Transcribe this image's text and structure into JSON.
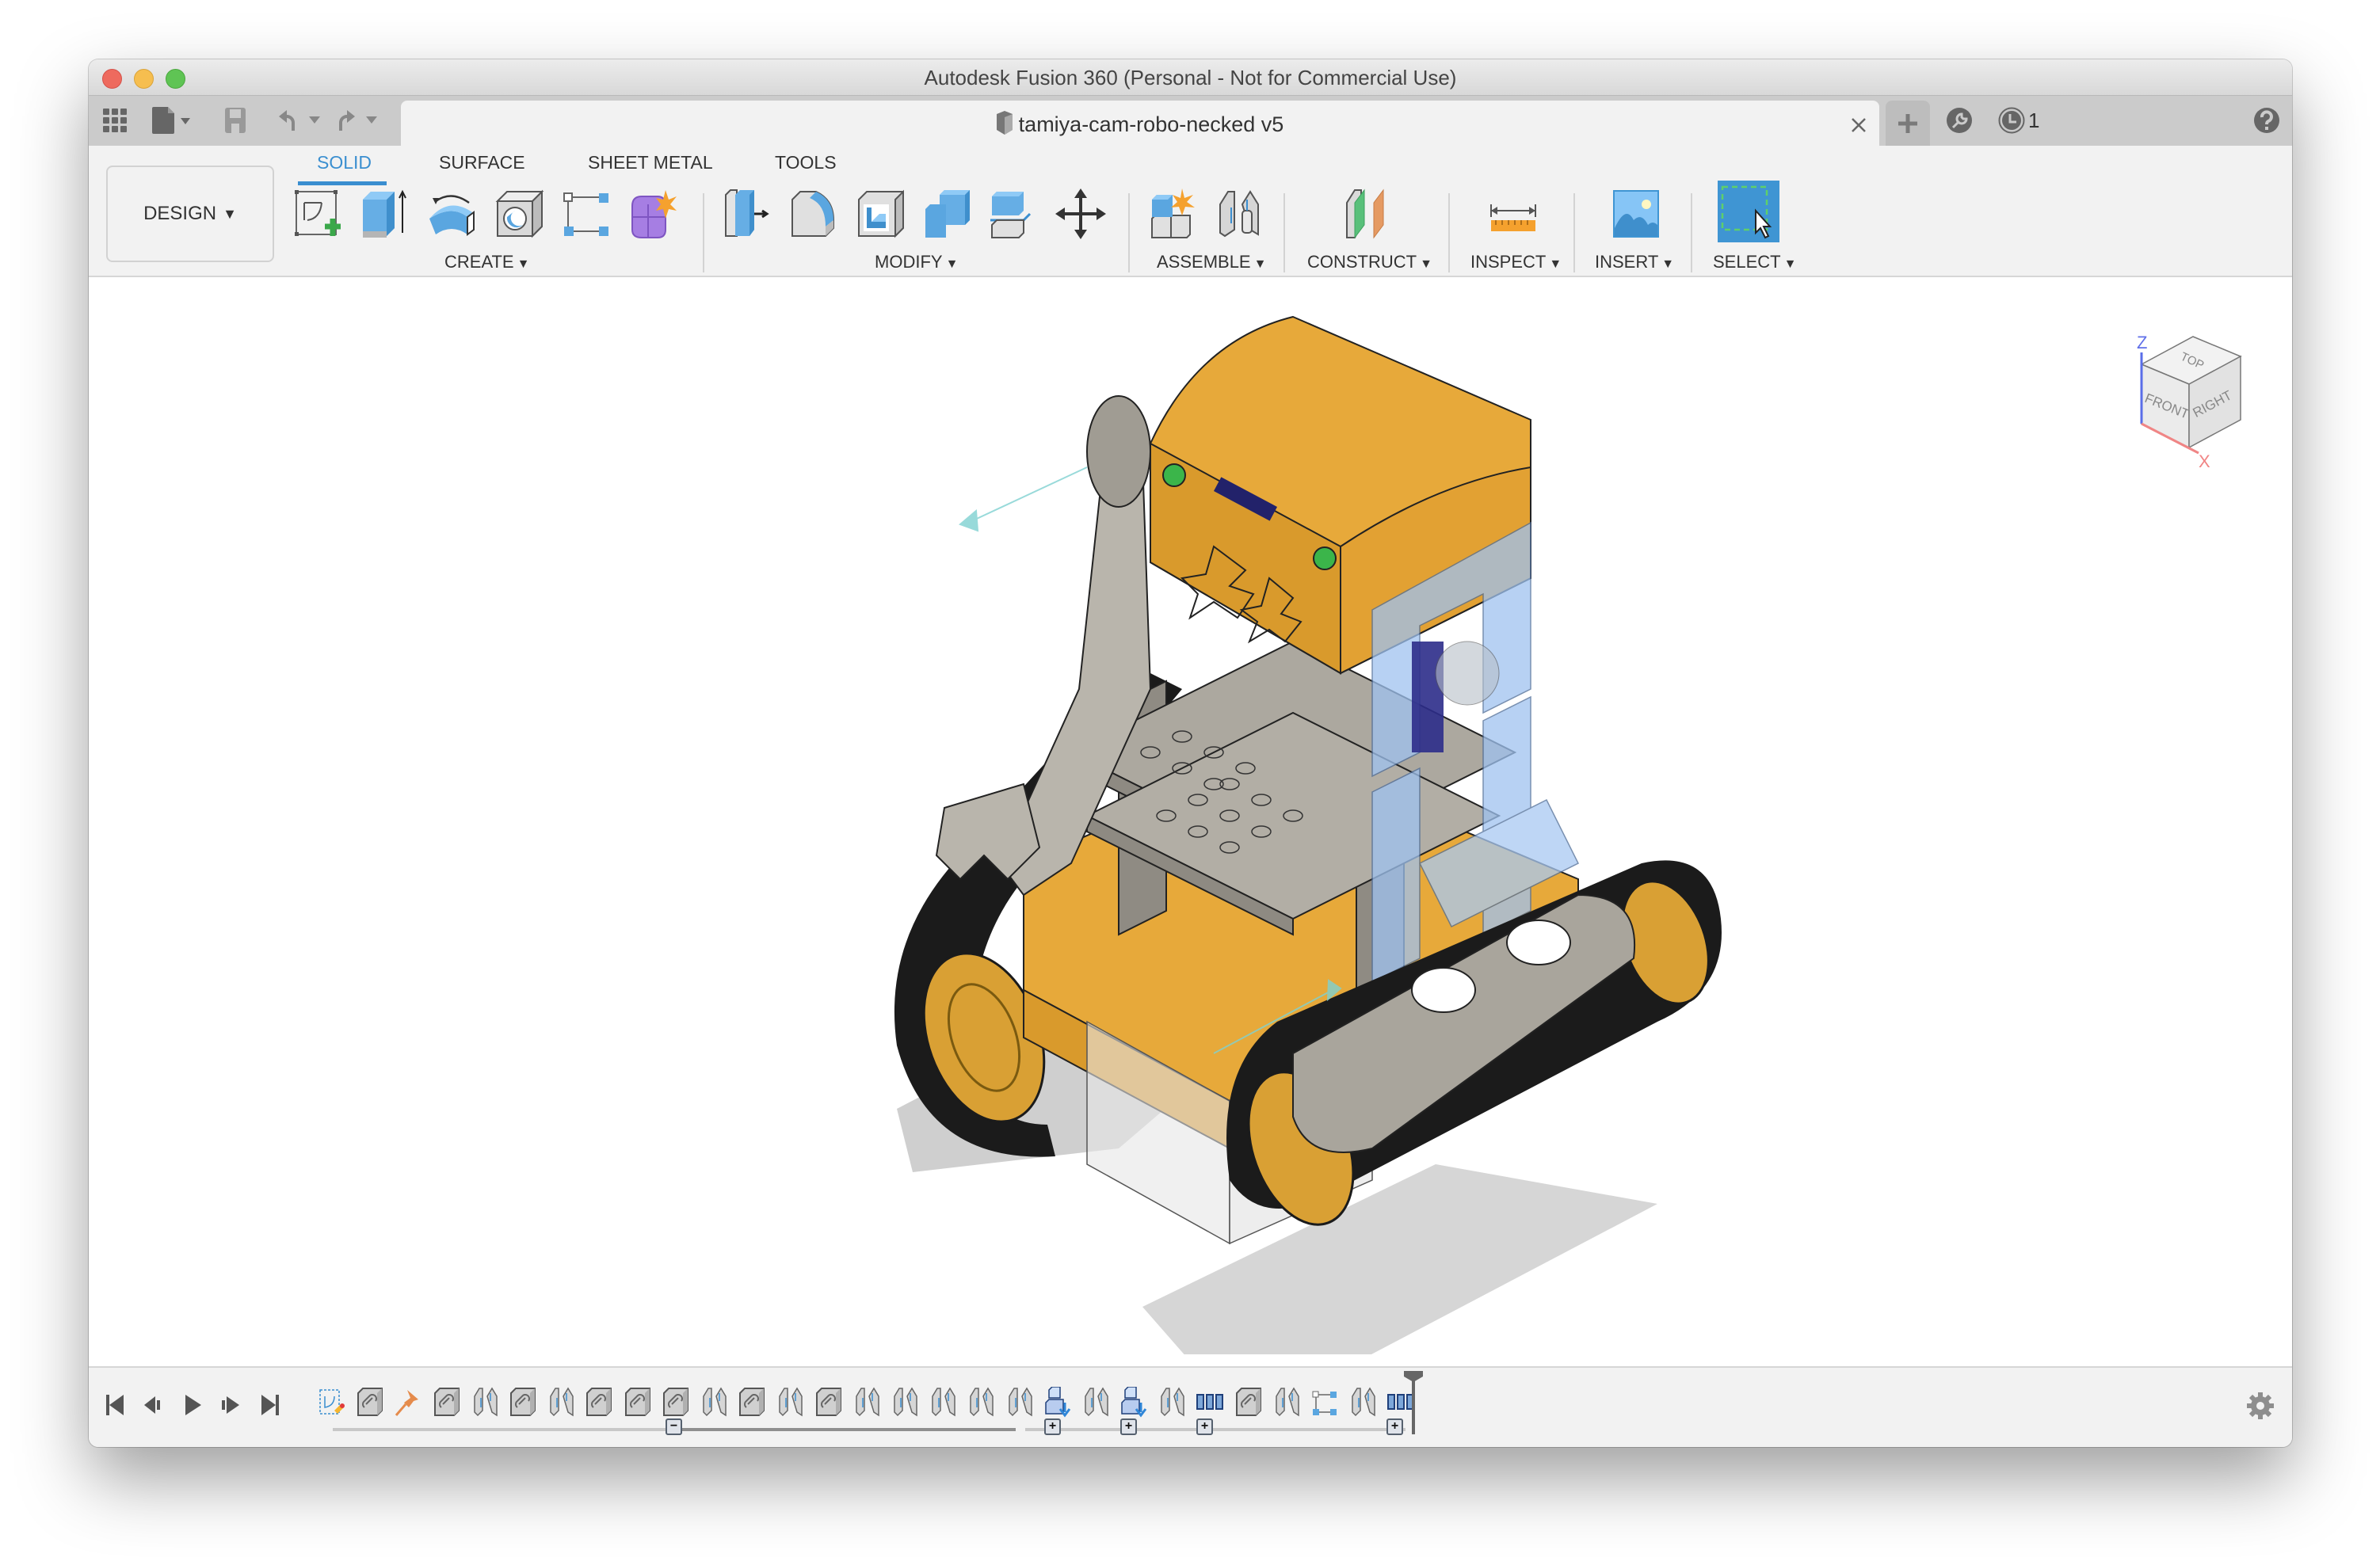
{
  "window": {
    "title": "Autodesk Fusion 360 (Personal - Not for Commercial Use)",
    "traffic_lights": [
      "close",
      "minimize",
      "zoom"
    ]
  },
  "tabbar": {
    "left_icons": [
      "app-grid-icon",
      "file-icon",
      "save-icon",
      "undo-icon",
      "redo-icon"
    ],
    "document_tab": {
      "label": "tamiya-cam-robo-necked v5",
      "icon": "component-cube-icon",
      "close_icon": "close-icon"
    },
    "new_tab_icon": "plus-icon",
    "extensions_icon": "wrench-icon",
    "job_status": {
      "icon": "clock-icon",
      "count": "1"
    },
    "help_icon": "help-icon"
  },
  "toolbar": {
    "workspace": {
      "label": "DESIGN",
      "caret": "▼"
    },
    "tabs": [
      {
        "label": "SOLID",
        "active": true
      },
      {
        "label": "SURFACE",
        "active": false
      },
      {
        "label": "SHEET METAL",
        "active": false
      },
      {
        "label": "TOOLS",
        "active": false
      }
    ],
    "groups": [
      {
        "label": "CREATE",
        "caret": "▼",
        "tools": [
          "create-sketch",
          "extrude",
          "revolve",
          "hole",
          "pattern",
          "create-form"
        ]
      },
      {
        "label": "MODIFY",
        "caret": "▼",
        "tools": [
          "press-pull",
          "fillet",
          "shell",
          "combine",
          "offset-face",
          "move-copy"
        ]
      },
      {
        "label": "ASSEMBLE",
        "caret": "▼",
        "tools": [
          "new-component",
          "joint"
        ]
      },
      {
        "label": "CONSTRUCT",
        "caret": "▼",
        "tools": [
          "offset-plane"
        ]
      },
      {
        "label": "INSPECT",
        "caret": "▼",
        "tools": [
          "measure"
        ]
      },
      {
        "label": "INSERT",
        "caret": "▼",
        "tools": [
          "insert-image"
        ]
      },
      {
        "label": "SELECT",
        "caret": "▼",
        "tools": [
          "window-select"
        ]
      }
    ],
    "colors": {
      "accent": "#3a8ed0",
      "select_bg": "#3f95d3"
    }
  },
  "viewport": {
    "viewcube": {
      "faces": [
        "TOP",
        "FRONT",
        "RIGHT"
      ],
      "axes": [
        "Z",
        "X"
      ]
    },
    "model_colors": {
      "body": "#e7a93a",
      "track": "#1b1b1b",
      "frame": "#a9a59c",
      "transparent_bracket": "#9fc2f0",
      "servo": "#2c2c8a",
      "led": "#3bb54a"
    }
  },
  "timeline": {
    "controls": [
      "go-to-start",
      "step-back",
      "play",
      "step-forward",
      "go-to-end"
    ],
    "features": [
      "sketch",
      "rigid-group",
      "ground",
      "rigid-group",
      "joint",
      "rigid-group",
      "joint",
      "rigid-group",
      "rigid-group",
      "rigid-group",
      "joint",
      "rigid-group",
      "joint",
      "rigid-group",
      "joint",
      "joint",
      "joint",
      "joint",
      "joint",
      "insert-derive",
      "joint",
      "insert-derive",
      "joint",
      "pattern",
      "rigid-group",
      "joint",
      "rectangular-pattern",
      "joint",
      "pattern"
    ],
    "group_buttons": [
      "−",
      "+",
      "+",
      "+",
      "+"
    ],
    "settings_icon": "gear-icon"
  }
}
